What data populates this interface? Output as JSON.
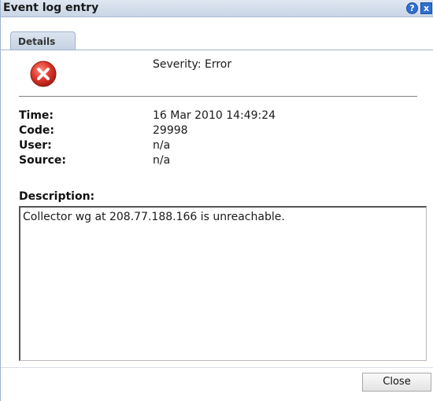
{
  "window": {
    "title": "Event log entry",
    "help_glyph": "?",
    "close_glyph": "x"
  },
  "tabs": [
    {
      "label": "Details",
      "selected": true
    }
  ],
  "severity": {
    "icon": "error-icon",
    "text": "Severity: Error"
  },
  "fields": [
    {
      "label": "Time:",
      "value": "16 Mar 2010 14:49:24"
    },
    {
      "label": "Code:",
      "value": "29998"
    },
    {
      "label": "User:",
      "value": "n/a"
    },
    {
      "label": "Source:",
      "value": "n/a"
    }
  ],
  "description": {
    "label": "Description:",
    "text": "Collector wg at 208.77.188.166 is unreachable."
  },
  "footer": {
    "close_label": "Close"
  },
  "colors": {
    "error_red": "#d9342b",
    "titlebar": "#c9d6e6",
    "accent_blue": "#2f6fd0"
  }
}
